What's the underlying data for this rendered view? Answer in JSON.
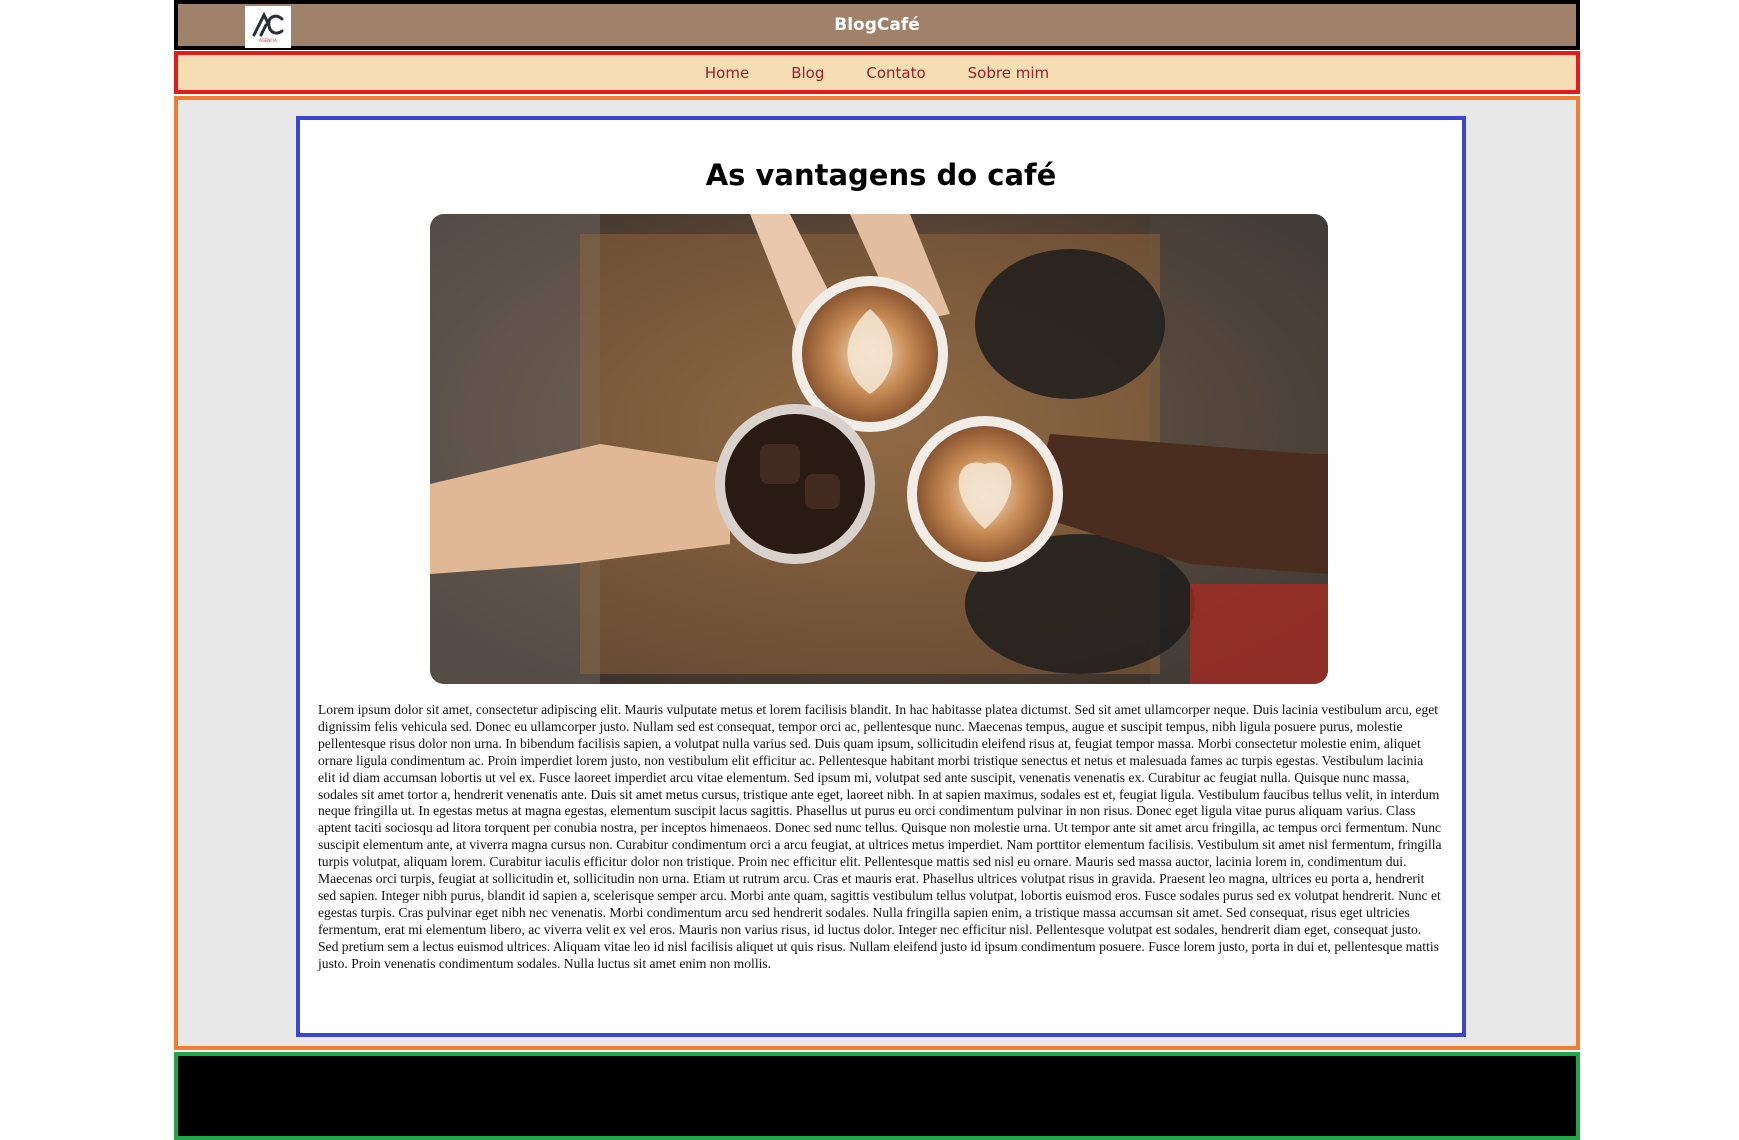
{
  "header": {
    "site_title": "BlogCafé",
    "logo_icon": "ac-logo-icon",
    "logo_subtext": "AGENCIA",
    "background_color": "#a0826a",
    "border_color": "#000000"
  },
  "nav": {
    "items": [
      {
        "label": "Home"
      },
      {
        "label": "Blog"
      },
      {
        "label": "Contato"
      },
      {
        "label": "Sobre mim"
      }
    ],
    "background_color": "#f5deb3",
    "border_color": "#e21b1b",
    "link_color": "#a0202a"
  },
  "article": {
    "title": "As vantagens do café",
    "image_icon": "coffee-cheers-photo",
    "body": "Lorem ipsum dolor sit amet, consectetur adipiscing elit. Mauris vulputate metus et lorem facilisis blandit. In hac habitasse platea dictumst. Sed sit amet ullamcorper neque. Duis lacinia vestibulum arcu, eget dignissim felis vehicula sed. Donec eu ullamcorper justo. Nullam sed est consequat, tempor orci ac, pellentesque nunc. Maecenas tempus, augue et suscipit tempus, nibh ligula posuere purus, molestie pellentesque risus dolor non urna. In bibendum facilisis sapien, a volutpat nulla varius sed. Duis quam ipsum, sollicitudin eleifend risus at, feugiat tempor massa. Morbi consectetur molestie enim, aliquet ornare ligula condimentum ac. Proin imperdiet lorem justo, non vestibulum elit efficitur ac. Pellentesque habitant morbi tristique senectus et netus et malesuada fames ac turpis egestas. Vestibulum lacinia elit id diam accumsan lobortis ut vel ex. Fusce laoreet imperdiet arcu vitae elementum. Sed ipsum mi, volutpat sed ante suscipit, venenatis venenatis ex. Curabitur ac feugiat nulla. Quisque nunc massa, sodales sit amet tortor a, hendrerit venenatis ante. Duis sit amet metus cursus, tristique ante eget, laoreet nibh. In at sapien maximus, sodales est et, feugiat ligula. Vestibulum faucibus tellus velit, in interdum neque fringilla ut. In egestas metus at magna egestas, elementum suscipit lacus sagittis. Phasellus ut purus eu orci condimentum pulvinar in non risus. Donec eget ligula vitae purus aliquam varius. Class aptent taciti sociosqu ad litora torquent per conubia nostra, per inceptos himenaeos. Donec sed nunc tellus. Quisque non molestie urna. Ut tempor ante sit amet arcu fringilla, ac tempus orci fermentum. Nunc suscipit elementum ante, at viverra magna cursus non. Curabitur condimentum orci a arcu feugiat, at ultrices metus imperdiet. Nam porttitor elementum facilisis. Vestibulum sit amet nisl fermentum, fringilla turpis volutpat, aliquam lorem. Curabitur iaculis efficitur dolor non tristique. Proin nec efficitur elit. Pellentesque mattis sed nisl eu ornare. Mauris sed massa auctor, lacinia lorem in, condimentum dui. Maecenas orci turpis, feugiat at sollicitudin et, sollicitudin non urna. Etiam ut rutrum arcu. Cras et mauris erat. Phasellus ultrices volutpat risus in gravida. Praesent leo magna, ultrices eu porta a, hendrerit sed sapien. Integer nibh purus, blandit id sapien a, scelerisque semper arcu. Morbi ante quam, sagittis vestibulum tellus volutpat, lobortis euismod eros. Fusce sodales purus sed ex volutpat hendrerit. Nunc et egestas turpis. Cras pulvinar eget nibh nec venenatis. Morbi condimentum arcu sed hendrerit sodales. Nulla fringilla sapien enim, a tristique massa accumsan sit amet. Sed consequat, risus eget ultricies fermentum, erat mi elementum libero, ac viverra velit ex vel eros. Mauris non varius risus, id luctus dolor. Integer nec efficitur nisl. Pellentesque volutpat est sodales, hendrerit diam eget, consequat justo. Sed pretium sem a lectus euismod ultrices. Aliquam vitae leo id nisl facilisis aliquet ut quis risus. Nullam eleifend justo id ipsum condimentum posuere. Fusce lorem justo, porta in dui et, pellentesque mattis justo. Proin venenatis condimentum sodales. Nulla luctus sit amet enim non mollis.",
    "border_color": "#3e44d2"
  },
  "main": {
    "background_color": "#e8e8e8",
    "border_color": "#f47c30"
  },
  "footer": {
    "background_color": "#000000",
    "border_color": "#1fa846"
  }
}
